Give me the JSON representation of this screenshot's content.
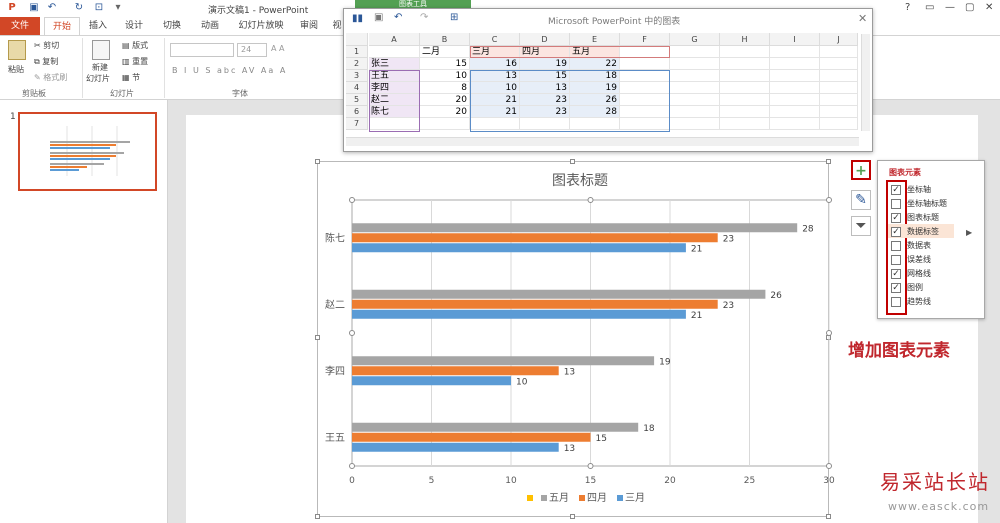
{
  "window": {
    "title": "演示文稿1 - PowerPoint",
    "contextual_tab_group": "图表工具",
    "controls": [
      "?",
      "▭",
      "—",
      "▢",
      "✕"
    ]
  },
  "tabs": [
    "文件",
    "开始",
    "插入",
    "设计",
    "切换",
    "动画",
    "幻灯片放映",
    "审阅",
    "视"
  ],
  "ribbon": {
    "clipboard": {
      "paste": "粘贴",
      "cut": "剪切",
      "copy": "复制",
      "format_painter": "格式刷",
      "group": "剪贴板"
    },
    "slides": {
      "new_slide_1": "新建",
      "new_slide_2": "幻灯片",
      "layout": "版式",
      "reset": "重置",
      "section": "节",
      "group": "幻灯片"
    },
    "font": {
      "size": "24",
      "group": "字体",
      "format_buttons": [
        "B",
        "I",
        "U",
        "S",
        "abc",
        "AV",
        "Aa",
        "A"
      ]
    }
  },
  "slide_thumb": {
    "number": "1"
  },
  "sheet": {
    "title": "Microsoft PowerPoint 中的图表",
    "columns": [
      "A",
      "B",
      "C",
      "D",
      "E",
      "F",
      "G",
      "H",
      "I",
      "J"
    ],
    "rows": [
      "1",
      "2",
      "3",
      "4",
      "5",
      "6",
      "7"
    ],
    "headers": [
      "",
      "二月",
      "三月",
      "四月",
      "五月"
    ],
    "data": [
      [
        "张三",
        "15",
        "16",
        "19",
        "22"
      ],
      [
        "王五",
        "10",
        "13",
        "15",
        "18"
      ],
      [
        "李四",
        "8",
        "10",
        "13",
        "19"
      ],
      [
        "赵二",
        "20",
        "21",
        "23",
        "26"
      ],
      [
        "陈七",
        "20",
        "21",
        "23",
        "28"
      ]
    ]
  },
  "chart_data": {
    "type": "bar",
    "orientation": "horizontal",
    "title": "图表标题",
    "categories": [
      "王五",
      "李四",
      "赵二",
      "陈七"
    ],
    "series": [
      {
        "name": "三月",
        "values": [
          13,
          10,
          21,
          21
        ],
        "color": "#5b9bd5"
      },
      {
        "name": "四月",
        "values": [
          15,
          13,
          23,
          23
        ],
        "color": "#ed7d31"
      },
      {
        "name": "五月",
        "values": [
          18,
          19,
          26,
          28
        ],
        "color": "#a5a5a5"
      }
    ],
    "xlim": [
      0,
      30
    ],
    "xticks": [
      "0",
      "5",
      "10",
      "15",
      "20",
      "25",
      "30"
    ],
    "grid": true,
    "legend_position": "bottom",
    "legend_order": [
      "五月",
      "四月",
      "三月"
    ],
    "legend_extra_marker_color": "#ffc000",
    "data_labels": true
  },
  "chart_elements_panel": {
    "title": "图表元素",
    "items": [
      {
        "label": "坐标轴",
        "checked": true
      },
      {
        "label": "坐标轴标题",
        "checked": false
      },
      {
        "label": "图表标题",
        "checked": true
      },
      {
        "label": "数据标签",
        "checked": true,
        "highlighted": true
      },
      {
        "label": "数据表",
        "checked": false
      },
      {
        "label": "误差线",
        "checked": false
      },
      {
        "label": "网格线",
        "checked": true
      },
      {
        "label": "图例",
        "checked": true
      },
      {
        "label": "趋势线",
        "checked": false
      }
    ]
  },
  "annotation": "增加图表元素",
  "watermark": {
    "cn": "易采站长站",
    "en": "www.easck.com"
  },
  "colors": {
    "accent": "#d24726",
    "annotation_red": "#c0272d",
    "chart_tools_green": "#53a053"
  }
}
